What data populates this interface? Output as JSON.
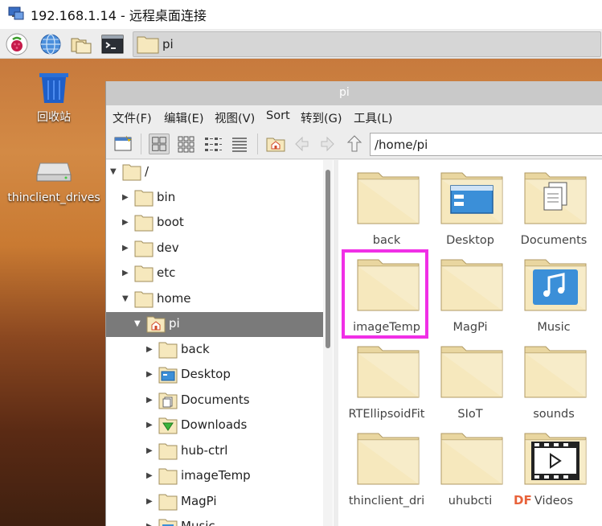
{
  "rdp": {
    "title": "192.168.1.14 - 远程桌面连接"
  },
  "taskbar": {
    "task_label": "pi"
  },
  "desktop": {
    "icons": [
      {
        "label": "回收站"
      },
      {
        "label": "thinclient_drives"
      }
    ]
  },
  "window": {
    "title": "pi",
    "menu": [
      "文件(F)",
      "编辑(E)",
      "视图(V)",
      "Sort",
      "转到(G)",
      "工具(L)"
    ],
    "path": "/home/pi"
  },
  "tree": [
    {
      "label": "/",
      "level": 0,
      "expanded": true
    },
    {
      "label": "bin",
      "level": 1
    },
    {
      "label": "boot",
      "level": 1
    },
    {
      "label": "dev",
      "level": 1
    },
    {
      "label": "etc",
      "level": 1
    },
    {
      "label": "home",
      "level": 1,
      "expanded": true
    },
    {
      "label": "pi",
      "level": 2,
      "expanded": true,
      "selected": true
    },
    {
      "label": "back",
      "level": 3
    },
    {
      "label": "Desktop",
      "level": 3
    },
    {
      "label": "Documents",
      "level": 3
    },
    {
      "label": "Downloads",
      "level": 3
    },
    {
      "label": "hub-ctrl",
      "level": 3
    },
    {
      "label": "imageTemp",
      "level": 3
    },
    {
      "label": "MagPi",
      "level": 3
    },
    {
      "label": "Music",
      "level": 3
    }
  ],
  "files": [
    {
      "label": "back"
    },
    {
      "label": "Desktop"
    },
    {
      "label": "Documents"
    },
    {
      "label": "imageTemp"
    },
    {
      "label": "MagPi"
    },
    {
      "label": "Music"
    },
    {
      "label": "RTEllipsoidFit"
    },
    {
      "label": "SIoT"
    },
    {
      "label": "sounds"
    },
    {
      "label": "thinclient_dri"
    },
    {
      "label": "uhubcti"
    },
    {
      "label": "Videos"
    }
  ],
  "watermark": "DF",
  "colors": {
    "highlight": "#f02fe6",
    "folder": "#f6e8bd",
    "selection": "#7a7a7a"
  }
}
